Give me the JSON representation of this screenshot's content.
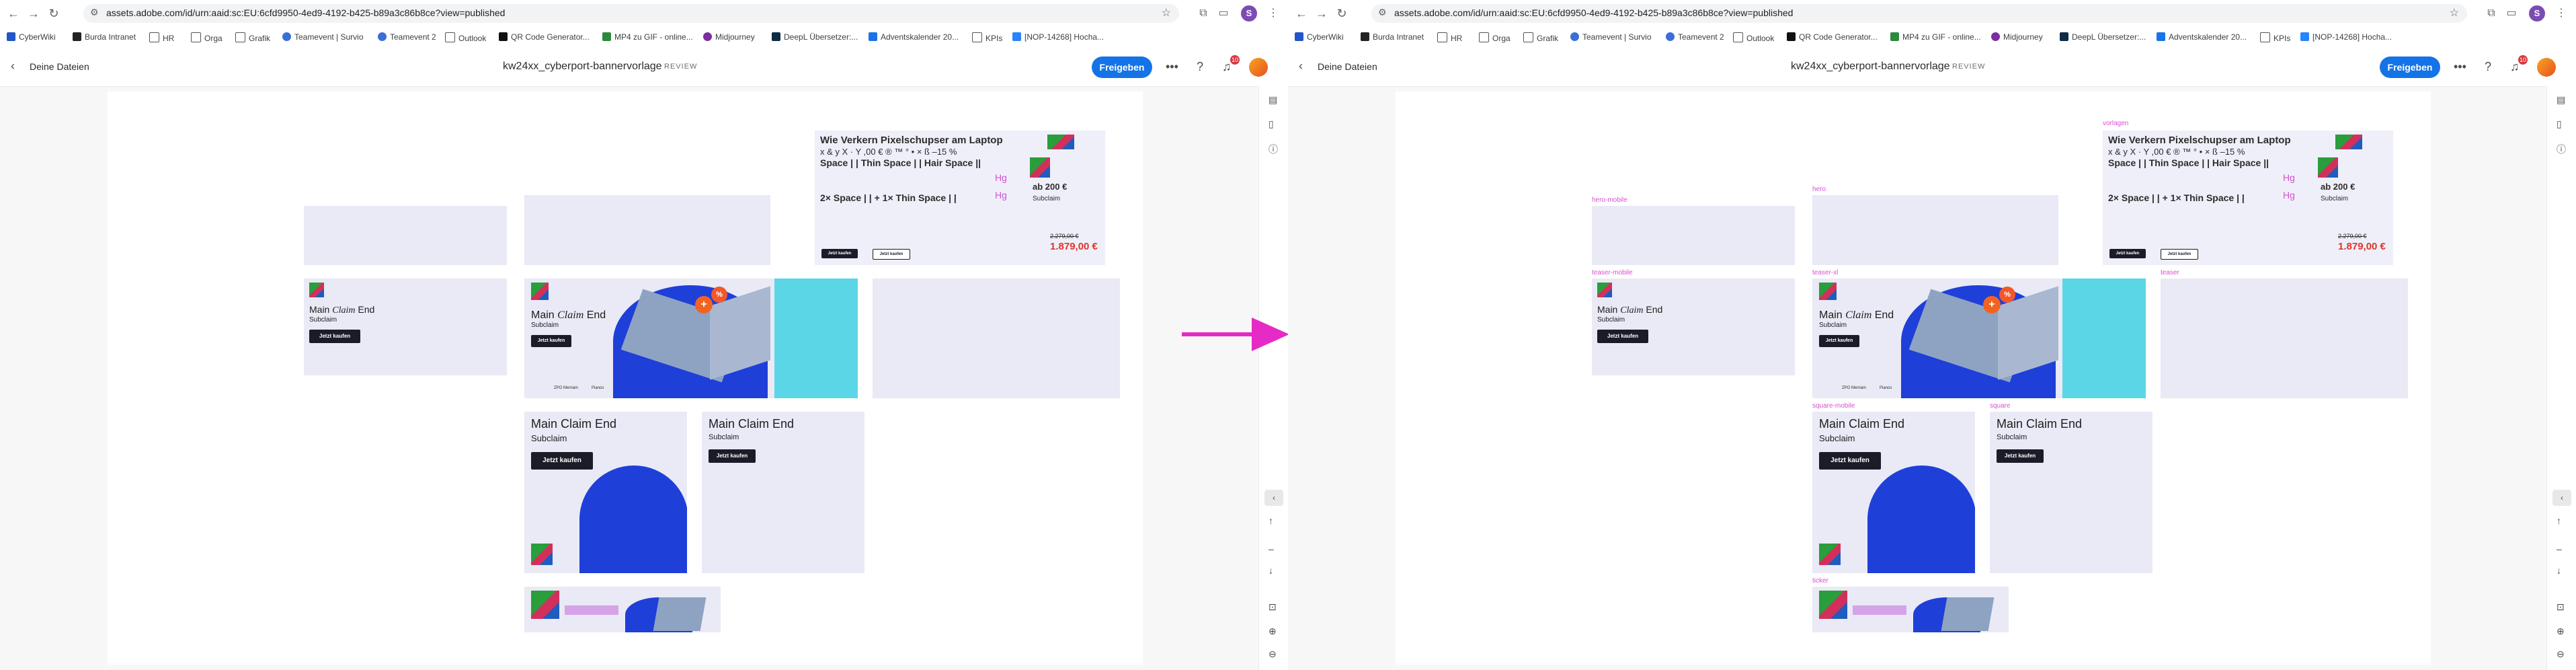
{
  "browser": {
    "url": "assets.adobe.com/id/urn:aaid:sc:EU:6cfd9950-4ed9-4192-b425-b89a3c86b8ce?view=published",
    "profile_initial": "S",
    "bookmarks": [
      {
        "label": "CyberWiki",
        "color": "#2156c9"
      },
      {
        "label": "Burda Intranet",
        "color": "#222222"
      },
      {
        "label": "HR",
        "color": "#666666"
      },
      {
        "label": "Orga",
        "color": "#666666"
      },
      {
        "label": "Grafik",
        "color": "#666666"
      },
      {
        "label": "Teamevent | Survio",
        "color": "#3a6fd8"
      },
      {
        "label": "Teamevent 2",
        "color": "#3a6fd8"
      },
      {
        "label": "Outlook",
        "color": "#666666"
      },
      {
        "label": "QR Code Generator...",
        "color": "#111111"
      },
      {
        "label": "MP4 zu GIF - online...",
        "color": "#2b8a3e"
      },
      {
        "label": "Midjourney",
        "color": "#7b2fa0"
      },
      {
        "label": "DeepL Übersetzer:...",
        "color": "#0f2b46"
      },
      {
        "label": "Adventskalender 20...",
        "color": "#1a73e8"
      },
      {
        "label": "KPIs",
        "color": "#666666"
      },
      {
        "label": "[NOP-14268] Hocha...",
        "color": "#2684ff"
      }
    ]
  },
  "app": {
    "back_label": "Deine Dateien",
    "doc_title": "kw24xx_cyberport-bannervorlage",
    "status": "REVIEW",
    "share_label": "Freigeben",
    "notification_count": "10"
  },
  "banners": {
    "headline_a": "Main ",
    "headline_italic": "Claim",
    "headline_b": " End",
    "headline_plain": "Main Claim End",
    "subclaim": "Subclaim",
    "cta": "Jetzt kaufen",
    "badge": "%",
    "tiny_1": "ZPO Merriam",
    "tiny_2": "Pianos"
  },
  "spec": {
    "line1": "Wie Verkern Pixelschupser am Laptop",
    "line2": "x & y  X · Y  ,00 € ® ™ ° • × ß  –15 %",
    "line3": "Space | |  Thin Space | |  Hair Space ||",
    "line4": "2× Space | | + 1× Thin Space | |",
    "hg": "Hg",
    "price_small": "ab 200 €",
    "subclaim": "Subclaim",
    "price_strike": "2.279,00 €",
    "price": "1.879,00 €"
  },
  "labels": {
    "vorlagen": "vorlagen",
    "hero_mobile": "hero-mobile",
    "hero": "hero",
    "teaser_mobile": "teaser-mobile",
    "teaser_xl": "teaser-xl",
    "teaser": "teaser",
    "square_mobile": "square-mobile",
    "square": "square",
    "ticker": "ticker"
  }
}
